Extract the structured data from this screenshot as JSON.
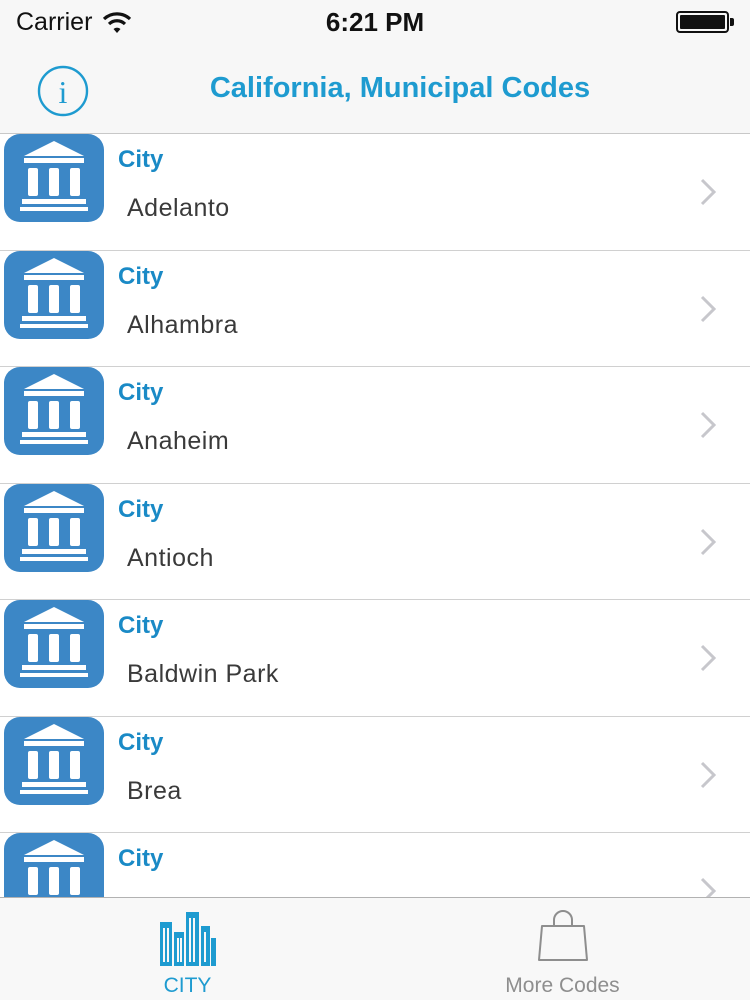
{
  "status_bar": {
    "carrier": "Carrier",
    "time": "6:21 PM",
    "icons": [
      "wifi-icon",
      "battery-icon"
    ]
  },
  "nav": {
    "title": "California, Municipal Codes",
    "info_icon": "info-icon"
  },
  "list": {
    "items": [
      {
        "type": "City",
        "name": "Adelanto"
      },
      {
        "type": "City",
        "name": "Alhambra"
      },
      {
        "type": "City",
        "name": "Anaheim"
      },
      {
        "type": "City",
        "name": "Antioch"
      },
      {
        "type": "City",
        "name": "Baldwin Park"
      },
      {
        "type": "City",
        "name": "Brea"
      },
      {
        "type": "City",
        "name": ""
      }
    ],
    "row_icon": "government-building-icon",
    "row_accessory": "chevron-right-icon"
  },
  "tab_bar": {
    "tabs": [
      {
        "label": "CITY",
        "icon": "city-buildings-icon",
        "selected": true
      },
      {
        "label": "More Codes",
        "icon": "shopping-bag-icon",
        "selected": false
      }
    ]
  },
  "colors": {
    "accent": "#1e9bd0",
    "icon_bg": "#3c87c6",
    "inactive": "#8e8e8e"
  }
}
